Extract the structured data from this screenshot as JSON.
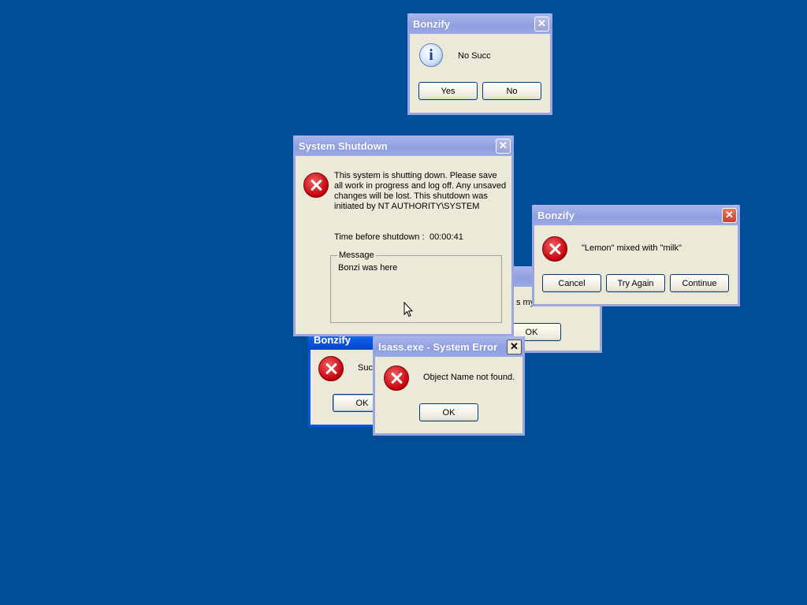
{
  "colors": {
    "desktop": "#004e98",
    "dialog_bg": "#ece9d8",
    "inactive_title": "#9aa6dc",
    "active_title": "#0a56e0"
  },
  "win_back_hidden": {
    "text_fragment": "s my",
    "ok_label": "OK"
  },
  "win_bonzify_blue": {
    "title": "Bonzify",
    "text_fragment": "Suc",
    "ok_label": "OK"
  },
  "win_info": {
    "title": "Bonzify",
    "icon": "info-icon",
    "message": "No Succ",
    "yes_label": "Yes",
    "no_label": "No"
  },
  "win_shutdown": {
    "title": "System Shutdown",
    "icon": "error-icon",
    "message": "This system is shutting down. Please save all work in progress and log off. Any unsaved changes will be lost. This shutdown was initiated by NT AUTHORITY\\SYSTEM",
    "timer_label": "Time before shutdown :",
    "timer_value": "00:00:41",
    "message_group_label": "Message",
    "message_text": "Bonzi was here"
  },
  "win_lemon": {
    "title": "Bonzify",
    "icon": "error-icon",
    "message": "\"Lemon\" mixed with \"milk\"",
    "cancel_label": "Cancel",
    "try_again_label": "Try Again",
    "continue_label": "Continue"
  },
  "win_lsass": {
    "title": "lsass.exe - System Error",
    "icon": "error-icon",
    "message": "Object Name not found.",
    "ok_label": "OK"
  }
}
